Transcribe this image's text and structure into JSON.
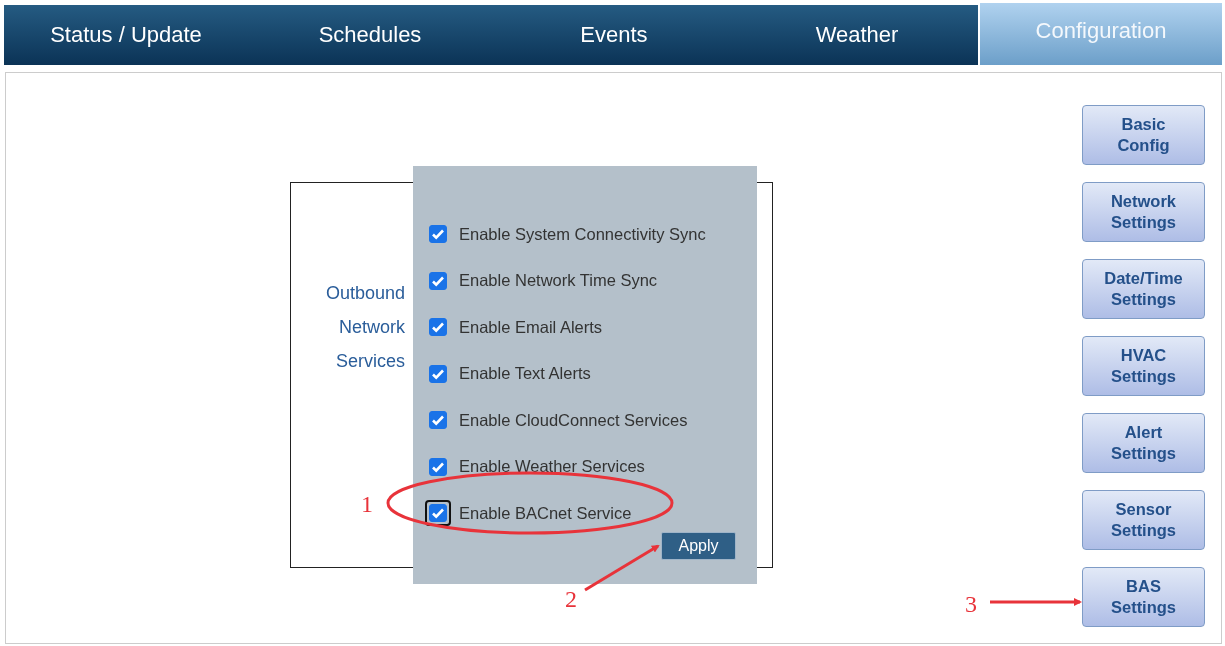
{
  "tabs": [
    {
      "label": "Status / Update",
      "selected": false
    },
    {
      "label": "Schedules",
      "selected": false
    },
    {
      "label": "Events",
      "selected": false
    },
    {
      "label": "Weather",
      "selected": false
    },
    {
      "label": "Configuration",
      "selected": true
    }
  ],
  "section": {
    "label": "Outbound Network Services",
    "options": [
      {
        "label": "Enable System Connectivity Sync",
        "checked": true,
        "focused": false
      },
      {
        "label": "Enable Network Time Sync",
        "checked": true,
        "focused": false
      },
      {
        "label": "Enable Email Alerts",
        "checked": true,
        "focused": false
      },
      {
        "label": "Enable Text Alerts",
        "checked": true,
        "focused": false
      },
      {
        "label": "Enable CloudConnect Services",
        "checked": true,
        "focused": false
      },
      {
        "label": "Enable Weather Services",
        "checked": true,
        "focused": false
      },
      {
        "label": "Enable BACnet Service",
        "checked": true,
        "focused": true
      }
    ],
    "apply_button": "Apply"
  },
  "side_buttons": [
    {
      "label": "Basic Config"
    },
    {
      "label": "Network Settings"
    },
    {
      "label": "Date/Time Settings"
    },
    {
      "label": "HVAC Settings"
    },
    {
      "label": "Alert Settings"
    },
    {
      "label": "Sensor Settings"
    },
    {
      "label": "BAS Settings"
    }
  ],
  "annotations": [
    {
      "label": "1",
      "kind": "ellipse"
    },
    {
      "label": "2",
      "kind": "arrow"
    },
    {
      "label": "3",
      "kind": "arrow"
    }
  ]
}
